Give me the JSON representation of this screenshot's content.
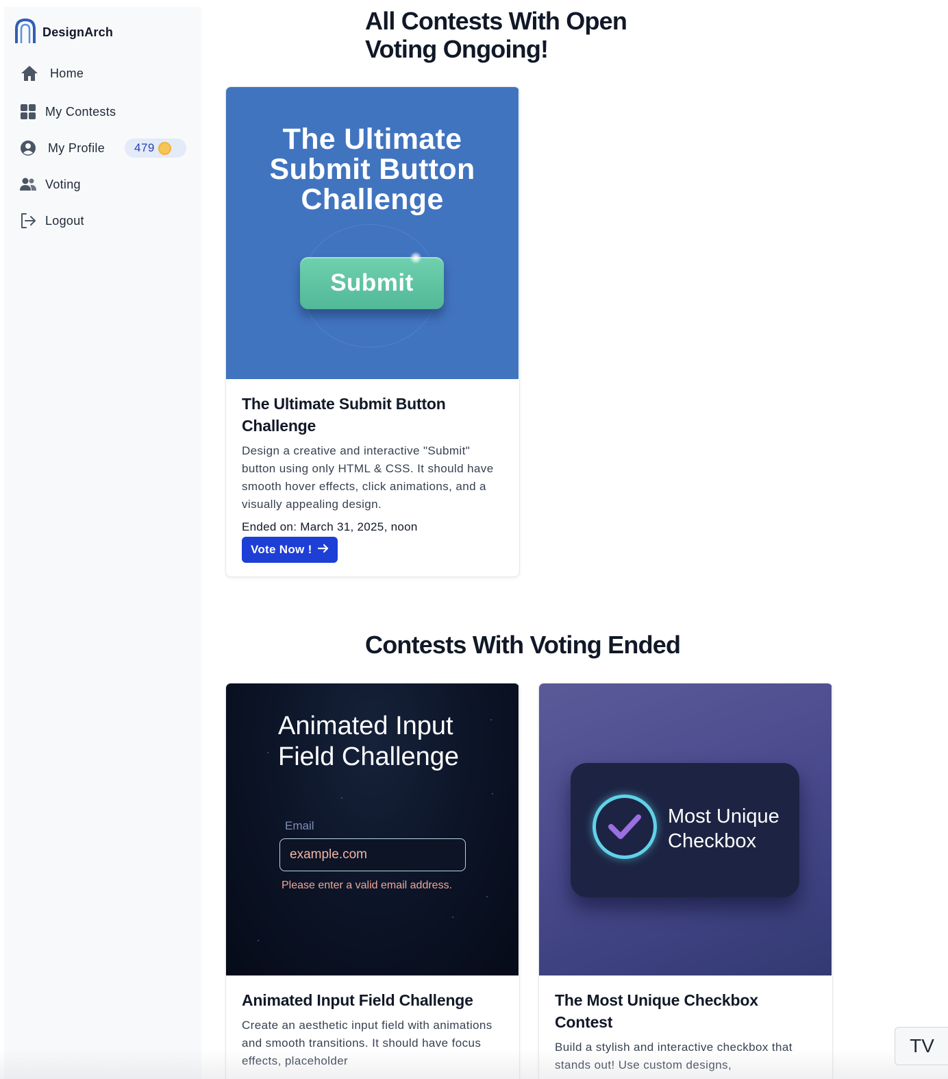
{
  "brand": {
    "name": "DesignArch",
    "logo_icon": "arch-logo-icon",
    "accent": "#2f5fb3"
  },
  "nav": {
    "items": [
      {
        "label": "Home",
        "icon": "home-icon"
      },
      {
        "label": "My Contests",
        "icon": "grid-icon"
      },
      {
        "label": "My Profile",
        "icon": "user-circle-icon"
      },
      {
        "label": "Voting",
        "icon": "users-icon"
      },
      {
        "label": "Logout",
        "icon": "logout-icon"
      }
    ],
    "points": "479",
    "points_icon": "coin-icon"
  },
  "sections": {
    "open_voting_title_line1": "All Contests With Open",
    "open_voting_title_line2": "Voting Ongoing!",
    "ended_title": "Contests With Voting Ended"
  },
  "open_contests": [
    {
      "thumb_title_lines": [
        "The Ultimate",
        "Submit Button",
        "Challenge"
      ],
      "thumb_button": "Submit",
      "title": "The Ultimate Submit Button Challenge",
      "description": "Design a creative and interactive \"Submit\" button using only HTML & CSS. It should have smooth hover effects, click animations, and a visually appealing design.",
      "ended_on": "Ended on: March 31, 2025, noon",
      "vote_label": "Vote Now !",
      "vote_icon": "arrow-right-icon"
    }
  ],
  "ended_contests": [
    {
      "thumb_title_lines": [
        "Animated Input",
        "Field Challenge"
      ],
      "thumb_label": "Email",
      "thumb_input_value": "example.com",
      "thumb_error": "Please enter a valid email address.",
      "title": "Animated Input Field Challenge",
      "description": "Create an aesthetic input field with animations and smooth transitions. It should have focus effects, placeholder"
    },
    {
      "thumb_title_lines": [
        "Most Unique",
        "Checkbox"
      ],
      "thumb_icon": "checkmark-icon",
      "title": "The Most Unique Checkbox Contest",
      "description": "Build a stylish and interactive checkbox that stands out! Use custom designs,"
    }
  ],
  "widget": {
    "label": "TV"
  }
}
